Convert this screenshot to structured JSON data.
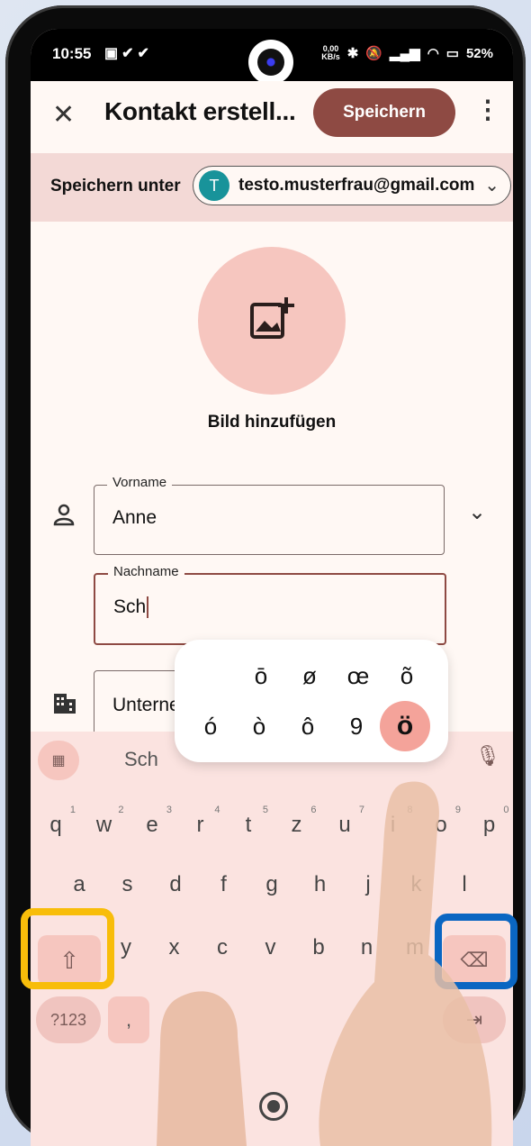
{
  "status": {
    "time": "10:55",
    "speed_value": "0,00",
    "speed_unit": "KB/s",
    "battery": "52%"
  },
  "appbar": {
    "close_icon": "close-icon",
    "title": "Kontakt erstell...",
    "save_label": "Speichern",
    "more_icon": "more-vert-icon"
  },
  "account": {
    "label": "Speichern unter",
    "avatar_letter": "T",
    "email": "testo.musterfrau@gmail.com"
  },
  "photo": {
    "icon": "add-photo-icon",
    "label": "Bild hinzufügen"
  },
  "fields": {
    "firstname": {
      "label": "Vorname",
      "value": "Anne"
    },
    "lastname": {
      "label": "Nachname",
      "value": "Sch"
    },
    "company": {
      "value": "Unternehm"
    }
  },
  "keyboard": {
    "suggestion": "Sch",
    "row1": [
      "q",
      "w",
      "e",
      "r",
      "t",
      "z",
      "u",
      "i",
      "o",
      "p"
    ],
    "row1_sup": [
      "1",
      "2",
      "3",
      "4",
      "5",
      "6",
      "7",
      "8",
      "9",
      "0"
    ],
    "row2": [
      "a",
      "s",
      "d",
      "f",
      "g",
      "h",
      "j",
      "k",
      "l"
    ],
    "row3": [
      "y",
      "x",
      "c",
      "v",
      "b",
      "n",
      "m"
    ],
    "sym_label": "?123",
    "comma_label": ",",
    "popup_row1": [
      "ō",
      "ø",
      "œ",
      "õ"
    ],
    "popup_row2": [
      "ó",
      "ò",
      "ô",
      "9",
      "ö"
    ]
  },
  "colors": {
    "accent": "#8e4a43",
    "highlight_yellow": "#f8bd0a",
    "highlight_blue": "#0a66c2"
  }
}
